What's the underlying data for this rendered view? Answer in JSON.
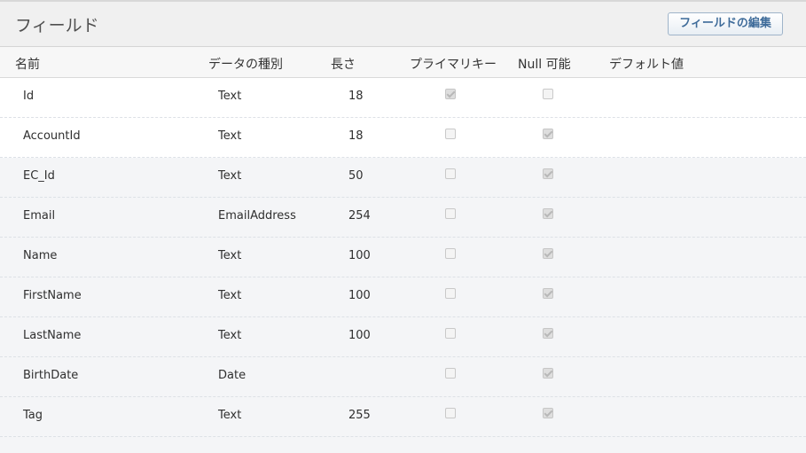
{
  "header": {
    "title": "フィールド",
    "edit_button_label": "フィールドの編集"
  },
  "columns": {
    "name": "名前",
    "data_type": "データの種別",
    "length": "長さ",
    "primary_key": "プライマリキー",
    "nullable": "Null 可能",
    "default_value": "デフォルト値"
  },
  "rows": [
    {
      "name": "Id",
      "data_type": "Text",
      "length": "18",
      "primary_key": true,
      "nullable": false,
      "default_value": ""
    },
    {
      "name": "AccountId",
      "data_type": "Text",
      "length": "18",
      "primary_key": false,
      "nullable": true,
      "default_value": ""
    },
    {
      "name": "EC_Id",
      "data_type": "Text",
      "length": "50",
      "primary_key": false,
      "nullable": true,
      "default_value": ""
    },
    {
      "name": "Email",
      "data_type": "EmailAddress",
      "length": "254",
      "primary_key": false,
      "nullable": true,
      "default_value": ""
    },
    {
      "name": "Name",
      "data_type": "Text",
      "length": "100",
      "primary_key": false,
      "nullable": true,
      "default_value": ""
    },
    {
      "name": "FirstName",
      "data_type": "Text",
      "length": "100",
      "primary_key": false,
      "nullable": true,
      "default_value": ""
    },
    {
      "name": "LastName",
      "data_type": "Text",
      "length": "100",
      "primary_key": false,
      "nullable": true,
      "default_value": ""
    },
    {
      "name": "BirthDate",
      "data_type": "Date",
      "length": "",
      "primary_key": false,
      "nullable": true,
      "default_value": ""
    },
    {
      "name": "Tag",
      "data_type": "Text",
      "length": "255",
      "primary_key": false,
      "nullable": true,
      "default_value": ""
    }
  ],
  "colors": {
    "header_background": "#f0f0f0",
    "button_text": "#3f6c9a",
    "row_white": "#ffffff",
    "row_grey": "#f4f5f7"
  }
}
